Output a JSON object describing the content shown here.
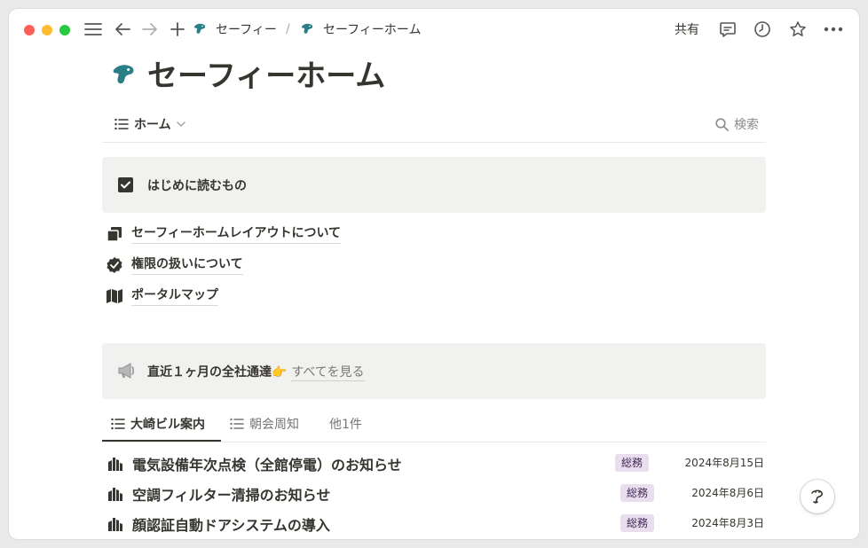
{
  "breadcrumb": {
    "parent": "セーフィー",
    "separator": "/",
    "current": "セーフィーホーム"
  },
  "toolbar": {
    "share_label": "共有"
  },
  "page": {
    "title": "セーフィーホーム"
  },
  "view": {
    "label": "ホーム",
    "search_label": "検索"
  },
  "callout_read_first": {
    "text": "はじめに読むもの"
  },
  "links": [
    {
      "icon": "copy-icon",
      "label": "セーフィーホームレイアウトについて"
    },
    {
      "icon": "verified-badge-icon",
      "label": "権限の扱いについて"
    },
    {
      "icon": "map-icon",
      "label": "ポータルマップ"
    }
  ],
  "callout_notice": {
    "text": "直近１ヶ月の全社通達",
    "pointer": "👉",
    "see_all": "すべてを見る"
  },
  "tabs": [
    {
      "label": "大崎ビル案内"
    },
    {
      "label": "朝会周知"
    },
    {
      "label": "他1件"
    }
  ],
  "announcements": [
    {
      "title": "電気設備年次点検（全館停電）のお知らせ",
      "tag": "総務",
      "date": "2024年8月15日"
    },
    {
      "title": "空調フィルター清掃のお知らせ",
      "tag": "総務",
      "date": "2024年8月6日"
    },
    {
      "title": "顔認証自動ドアシステムの導入",
      "tag": "総務",
      "date": "2024年8月3日"
    }
  ],
  "colors": {
    "text": "#37352f",
    "callout_bg": "#f1f1ef",
    "tag_bg": "#e8deee",
    "tag_text": "#412454",
    "brand_logo": "#2a7f86"
  }
}
